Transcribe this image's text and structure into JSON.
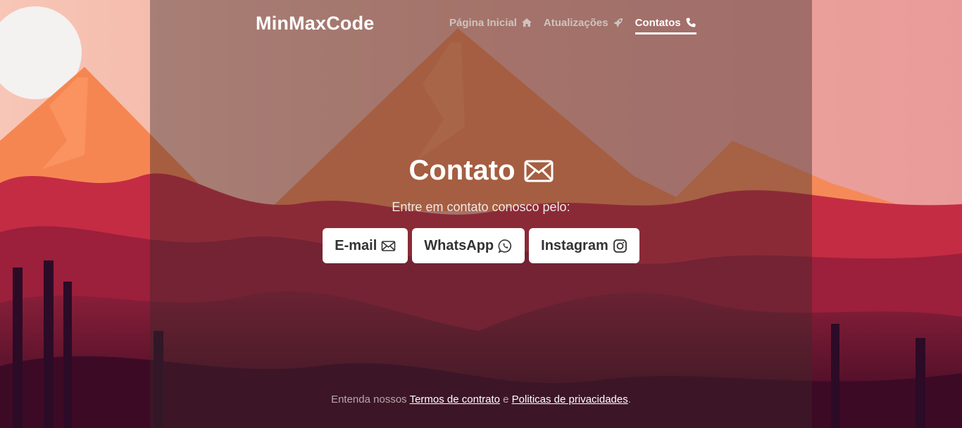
{
  "brand": "MinMaxCode",
  "nav": {
    "home": "Página Inicial",
    "updates": "Atualizações",
    "contacts": "Contatos"
  },
  "contact": {
    "title": "Contato",
    "subtitle": "Entre em contato conosco pelo:"
  },
  "buttons": {
    "email": "E-mail",
    "whatsapp": "WhatsApp",
    "instagram": "Instagram"
  },
  "footer": {
    "prefix": "Entenda nossos",
    "terms": "Termos de contrato",
    "and": "e",
    "privacy": "Politicas de privacidades",
    "suffix": "."
  },
  "icons": {
    "home": "home-icon",
    "updates": "rocket-icon",
    "contacts": "phone-icon",
    "title": "envelope-icon",
    "email": "envelope-icon",
    "whatsapp": "whatsapp-icon",
    "instagram": "instagram-icon"
  },
  "colors": {
    "sky": "#f6c4b0",
    "mountain": "#f08050",
    "foliage": "#b82840",
    "foreground": "#5a0f2a",
    "button_bg": "#ffffff",
    "text_white": "#ffffff"
  }
}
